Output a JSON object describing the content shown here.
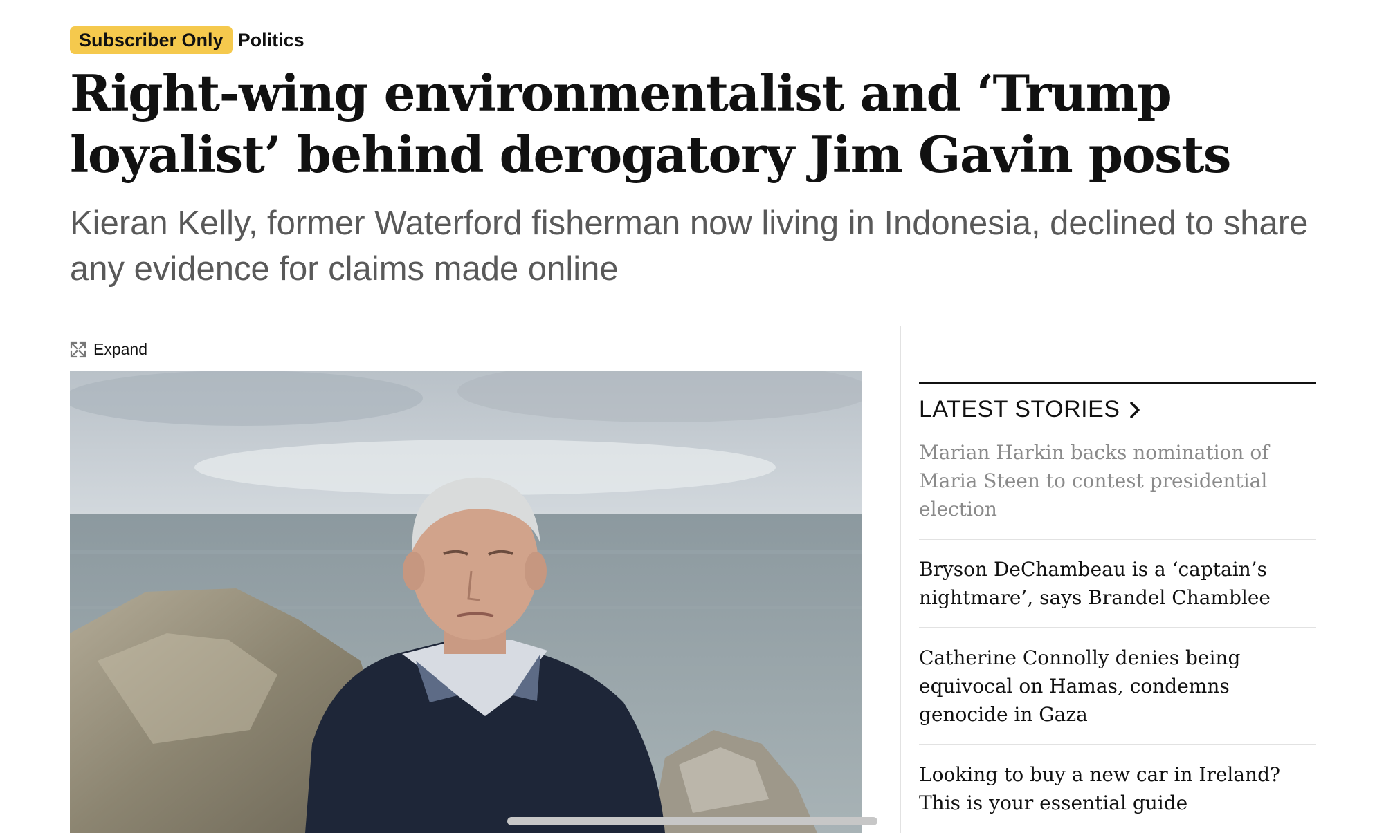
{
  "article": {
    "badge": "Subscriber Only",
    "section": "Politics",
    "headline": "Right-wing environmentalist and ‘Trump loyalist’ behind derogatory Jim Gavin posts",
    "standfirst": "Kieran Kelly, former Waterford fisherman now living in Indonesia, declined to share any evidence for claims made online",
    "expand_label": "Expand"
  },
  "sidebar": {
    "heading": "LATEST STORIES",
    "stories": [
      "Marian Harkin backs nomination of Maria Steen to contest presidential election",
      "Bryson DeChambeau is a ‘captain’s nightmare’, says Brandel Chamblee",
      "Catherine Connolly denies being equivocal on Hamas, condemns genocide in Gaza",
      "Looking to buy a new car in Ireland? This is your essential guide"
    ]
  },
  "colors": {
    "badge_bg": "#f5c94d",
    "standfirst": "#595959",
    "read_story": "#8a8a8a"
  },
  "icons": {
    "expand": "expand-arrows-icon",
    "chevron": "chevron-right-icon"
  }
}
